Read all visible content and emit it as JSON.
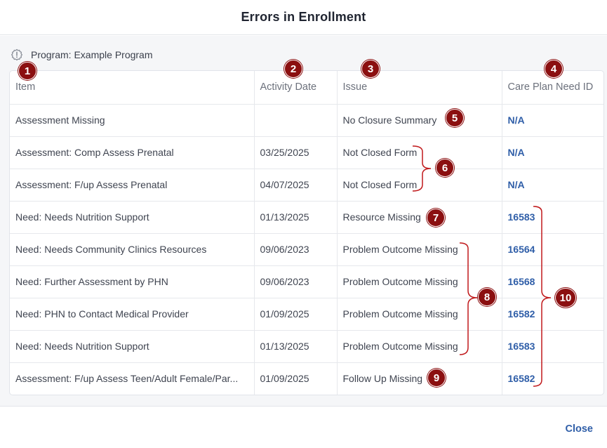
{
  "modal": {
    "title": "Errors in Enrollment",
    "program_label": "Program: Example Program",
    "close_label": "Close"
  },
  "table": {
    "headers": {
      "item": "Item",
      "activity_date": "Activity Date",
      "issue": "Issue",
      "care_plan_need_id": "Care Plan Need ID"
    },
    "rows": [
      {
        "item": "Assessment Missing",
        "date": "",
        "issue": "No Closure Summary",
        "id": "N/A"
      },
      {
        "item": "Assessment: Comp Assess Prenatal",
        "date": "03/25/2025",
        "issue": "Not Closed Form",
        "id": "N/A"
      },
      {
        "item": "Assessment: F/up Assess Prenatal",
        "date": "04/07/2025",
        "issue": "Not Closed Form",
        "id": "N/A"
      },
      {
        "item": "Need: Needs Nutrition Support",
        "date": "01/13/2025",
        "issue": "Resource Missing",
        "id": "16583"
      },
      {
        "item": "Need: Needs Community Clinics Resources",
        "date": "09/06/2023",
        "issue": "Problem Outcome Missing",
        "id": "16564"
      },
      {
        "item": "Need: Further Assessment by PHN",
        "date": "09/06/2023",
        "issue": "Problem Outcome Missing",
        "id": "16568"
      },
      {
        "item": "Need: PHN to Contact Medical Provider",
        "date": "01/09/2025",
        "issue": "Problem Outcome Missing",
        "id": "16582"
      },
      {
        "item": "Need: Needs Nutrition Support",
        "date": "01/13/2025",
        "issue": "Problem Outcome Missing",
        "id": "16583"
      },
      {
        "item": "Assessment: F/up Assess Teen/Adult Female/Par...",
        "date": "01/09/2025",
        "issue": "Follow Up Missing",
        "id": "16582"
      }
    ]
  },
  "annotations": {
    "markers": [
      "1",
      "2",
      "3",
      "4",
      "5",
      "6",
      "7",
      "8",
      "9",
      "10"
    ],
    "marker_color": "#8b0f10",
    "bracket_color": "#c0191b"
  },
  "colors": {
    "link": "#2f5ea8",
    "body_bg": "#f5f6f8"
  }
}
